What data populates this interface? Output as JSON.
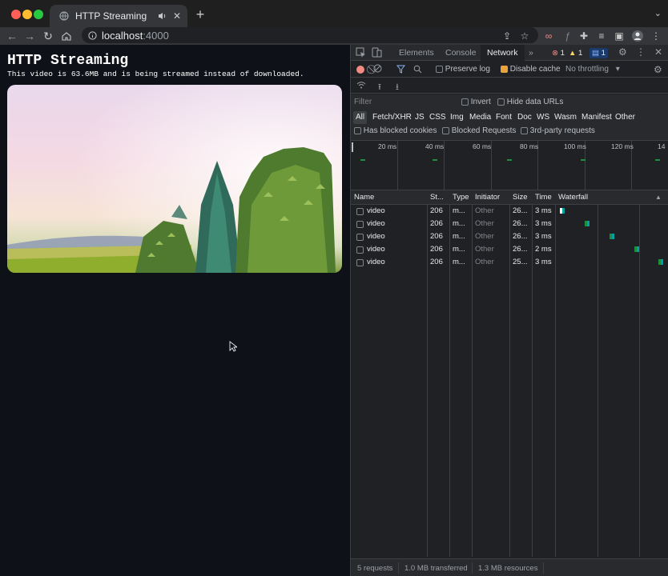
{
  "browser": {
    "tab_title": "HTTP Streaming",
    "url_host": "localhost",
    "url_port": ":4000"
  },
  "page": {
    "heading": "HTTP Streaming",
    "subtitle": "This video is 63.6MB and is being streamed instead of downloaded."
  },
  "devtools": {
    "tabs": [
      "Elements",
      "Console",
      "Network"
    ],
    "more": "»",
    "errors": "1",
    "warnings": "1",
    "issues": "1",
    "preserve_log": "Preserve log",
    "disable_cache": "Disable cache",
    "throttling": "No throttling",
    "filter_placeholder": "Filter",
    "invert": "Invert",
    "hide_data_urls": "Hide data URLs",
    "types": [
      "All",
      "Fetch/XHR",
      "JS",
      "CSS",
      "Img",
      "Media",
      "Font",
      "Doc",
      "WS",
      "Wasm",
      "Manifest",
      "Other"
    ],
    "blocked_cookies": "Has blocked cookies",
    "blocked_requests": "Blocked Requests",
    "third_party": "3rd-party requests",
    "overview_ticks": [
      "20 ms",
      "40 ms",
      "60 ms",
      "80 ms",
      "100 ms",
      "120 ms",
      "14"
    ],
    "columns": [
      "Name",
      "St...",
      "Type",
      "Initiator",
      "Size",
      "Time",
      "Waterfall"
    ],
    "rows": [
      {
        "name": "video",
        "status": "206",
        "type": "m...",
        "initiator": "Other",
        "size": "26...",
        "time": "3 ms",
        "wf_start": 0.0
      },
      {
        "name": "video",
        "status": "206",
        "type": "m...",
        "initiator": "Other",
        "size": "26...",
        "time": "3 ms",
        "wf_start": 0.25
      },
      {
        "name": "video",
        "status": "206",
        "type": "m...",
        "initiator": "Other",
        "size": "26...",
        "time": "3 ms",
        "wf_start": 0.5
      },
      {
        "name": "video",
        "status": "206",
        "type": "m...",
        "initiator": "Other",
        "size": "26...",
        "time": "2 ms",
        "wf_start": 0.75
      },
      {
        "name": "video",
        "status": "206",
        "type": "m...",
        "initiator": "Other",
        "size": "25...",
        "time": "3 ms",
        "wf_start": 0.99
      }
    ],
    "status_bar": {
      "requests": "5 requests",
      "transferred": "1.0 MB transferred",
      "resources": "1.3 MB resources"
    }
  },
  "colors": {
    "accent_blue": "#8ab4f8",
    "record_red": "#f28b82",
    "waterfall_teal": "#00a3a3"
  }
}
